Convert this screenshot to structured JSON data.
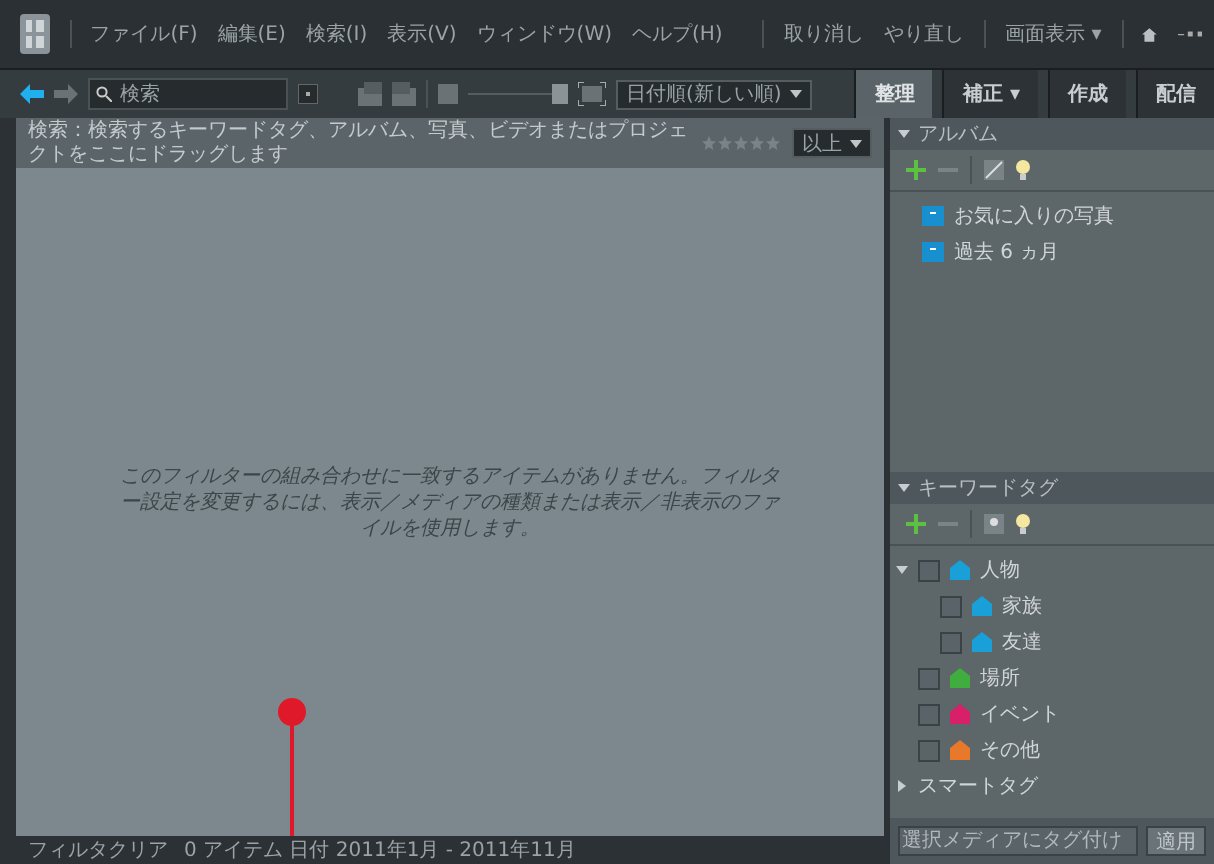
{
  "menu": [
    "ファイル(F)",
    "編集(E)",
    "検索(I)",
    "表示(V)",
    "ウィンドウ(W)",
    "ヘルプ(H)"
  ],
  "top_actions": {
    "undo": "取り消し",
    "redo": "やり直し",
    "display": "画面表示 ▾"
  },
  "search": {
    "placeholder": "検索"
  },
  "sort": {
    "value": "日付順(新しい順)"
  },
  "thumbnail_slider": {
    "level": 1
  },
  "tabs": [
    {
      "label": "整理",
      "selected": true
    },
    {
      "label": "補正 ▾",
      "selected": false
    },
    {
      "label": "作成",
      "selected": false
    },
    {
      "label": "配信",
      "selected": false
    }
  ],
  "hint_bar": {
    "text": "検索：検索するキーワードタグ、アルバム、写真、ビデオまたはプロジェクトをここにドラッグします",
    "stars": 0,
    "rating_filter": "以上"
  },
  "empty_message": "このフィルターの組み合わせに一致するアイテムがありません。フィルター設定を変更するには、表示／メディアの種類または表示／非表示のファイルを使用します。",
  "status_bar": [
    "フィルタクリア",
    "0 アイテム 日付 2011年1月 - 2011年11月"
  ],
  "albums": {
    "title": "アルバム",
    "expanded": true,
    "items": [
      "お気に入りの写真",
      "過去 6 ヵ月"
    ]
  },
  "keyword_tags": {
    "title": "キーワードタグ",
    "expanded": true,
    "items": [
      {
        "label": "人物",
        "color": "#1aa0d8",
        "checked": false,
        "expanded": true,
        "children": [
          {
            "label": "家族",
            "color": "#1aa0d8",
            "checked": false
          },
          {
            "label": "友達",
            "color": "#1aa0d8",
            "checked": false
          }
        ]
      },
      {
        "label": "場所",
        "color": "#3fae3f",
        "checked": false
      },
      {
        "label": "イベント",
        "color": "#d8206a",
        "checked": false
      },
      {
        "label": "その他",
        "color": "#e8782a",
        "checked": false
      },
      {
        "label": "スマートタグ",
        "expanded": false,
        "smart": true
      }
    ]
  },
  "tag_field": {
    "placeholder": "選択メディアにタグ付け"
  },
  "apply_button": "適用"
}
